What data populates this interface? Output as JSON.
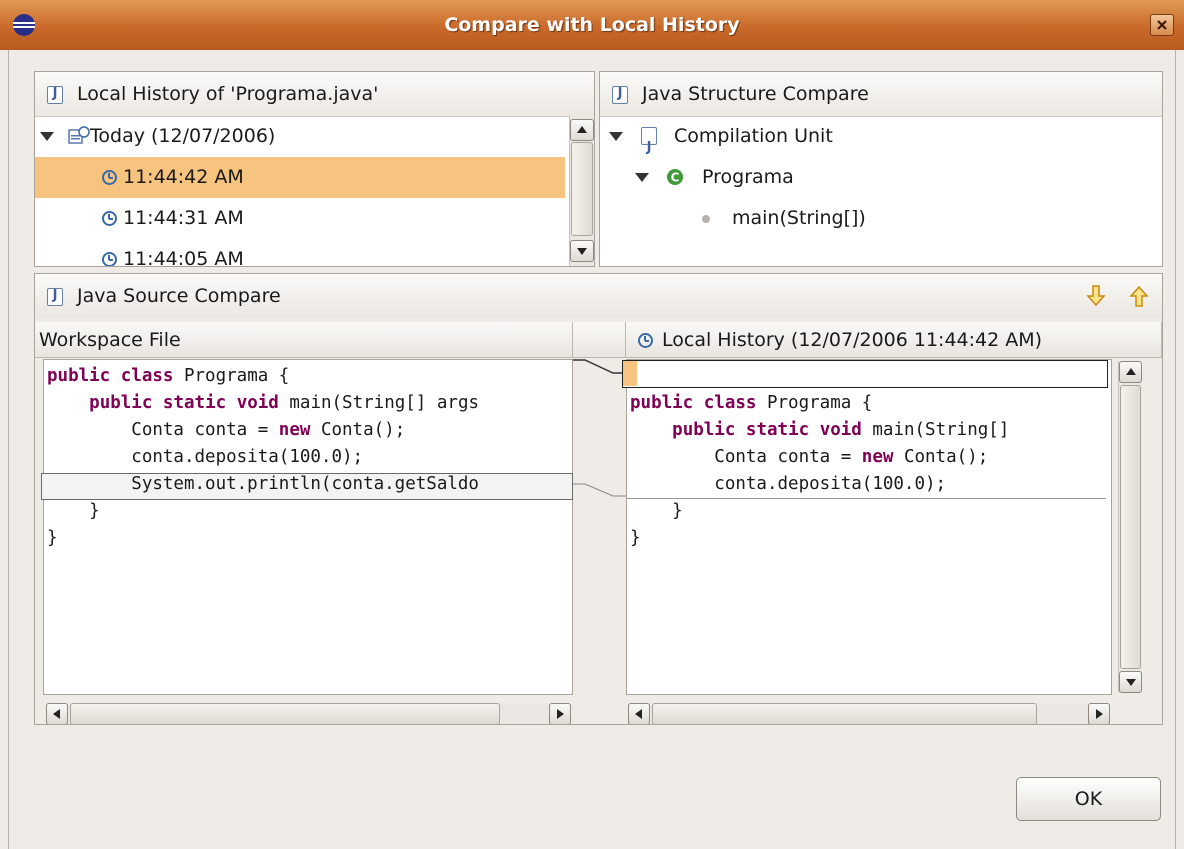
{
  "window": {
    "title": "Compare with Local History",
    "accent": "#c9692a",
    "selection_color": "#f7c47f"
  },
  "history_panel": {
    "title": "Local History of 'Programa.java'",
    "group_label": "Today (12/07/2006)",
    "entries": [
      "11:44:42 AM",
      "11:44:31 AM",
      "11:44:05 AM"
    ],
    "selected_index": 0
  },
  "structure_panel": {
    "title": "Java Structure Compare",
    "root": "Compilation Unit",
    "class_name": "Programa",
    "method": "main(String[])"
  },
  "source_panel": {
    "title": "Java Source Compare",
    "left_header": "Workspace File",
    "right_header": "Local History (12/07/2006 11:44:42 AM)",
    "left_code": [
      "public class Programa {",
      "    public static void main(String[] args",
      "        Conta conta = new Conta();",
      "        conta.deposita(100.0);",
      "        System.out.println(conta.getSaldo",
      "    }",
      "}"
    ],
    "right_code": [
      "",
      "public class Programa {",
      "    public static void main(String[]",
      "        Conta conta = new Conta();",
      "        conta.deposita(100.0);",
      "    }",
      "}"
    ],
    "keywords": [
      "public",
      "class",
      "static",
      "void",
      "new"
    ],
    "keyword_color": "#7f0055"
  },
  "buttons": {
    "ok": "OK"
  },
  "icons": {
    "next_difference": "arrow-down-icon",
    "previous_difference": "arrow-up-icon"
  }
}
